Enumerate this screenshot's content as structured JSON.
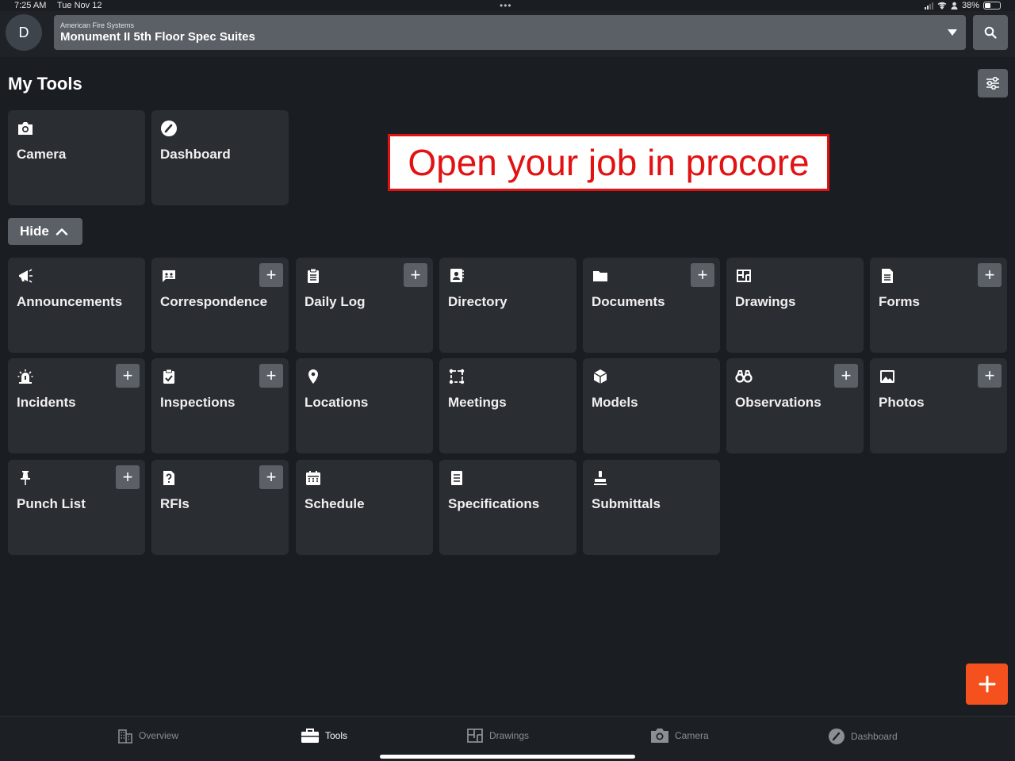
{
  "status_bar": {
    "time": "7:25 AM",
    "date": "Tue Nov 12",
    "dots": "•••",
    "battery": "38%",
    "battery_level": 0.38
  },
  "header": {
    "avatar_initial": "D",
    "company": "American Fire Systems",
    "project": "Monument II 5th Floor Spec Suites",
    "search_icon": "search-icon"
  },
  "page": {
    "title": "My Tools",
    "settings_icon": "sliders-icon"
  },
  "favorites": [
    {
      "label": "Camera",
      "icon": "camera-icon"
    },
    {
      "label": "Dashboard",
      "icon": "gauge-icon"
    }
  ],
  "hide_button": {
    "label": "Hide",
    "icon": "chevron-up-icon"
  },
  "callout": {
    "text": "Open your job in procore",
    "color": "#e31212"
  },
  "tools": [
    {
      "label": "Announcements",
      "icon": "megaphone-icon",
      "add": false
    },
    {
      "label": "Correspondence",
      "icon": "chat-icon",
      "add": true
    },
    {
      "label": "Daily Log",
      "icon": "clipboard-icon",
      "add": true
    },
    {
      "label": "Directory",
      "icon": "contact-book-icon",
      "add": false
    },
    {
      "label": "Documents",
      "icon": "folder-icon",
      "add": true
    },
    {
      "label": "Drawings",
      "icon": "floorplan-icon",
      "add": false
    },
    {
      "label": "Forms",
      "icon": "form-icon",
      "add": true
    },
    {
      "label": "Incidents",
      "icon": "siren-icon",
      "add": true
    },
    {
      "label": "Inspections",
      "icon": "clipboard-check-icon",
      "add": true
    },
    {
      "label": "Locations",
      "icon": "map-pin-icon",
      "add": false
    },
    {
      "label": "Meetings",
      "icon": "meeting-icon",
      "add": false
    },
    {
      "label": "Models",
      "icon": "cube-icon",
      "add": false
    },
    {
      "label": "Observations",
      "icon": "binoculars-icon",
      "add": true
    },
    {
      "label": "Photos",
      "icon": "image-icon",
      "add": true
    },
    {
      "label": "Punch List",
      "icon": "pushpin-icon",
      "add": true
    },
    {
      "label": "RFIs",
      "icon": "question-doc-icon",
      "add": true
    },
    {
      "label": "Schedule",
      "icon": "calendar-icon",
      "add": false
    },
    {
      "label": "Specifications",
      "icon": "spec-doc-icon",
      "add": false
    },
    {
      "label": "Submittals",
      "icon": "stamp-icon",
      "add": false
    }
  ],
  "add_symbol": "+",
  "fab": {
    "icon": "plus-icon",
    "color": "#f4511e"
  },
  "bottom_nav": [
    {
      "label": "Overview",
      "icon": "building-icon",
      "active": false
    },
    {
      "label": "Tools",
      "icon": "toolbox-icon",
      "active": true
    },
    {
      "label": "Drawings",
      "icon": "floorplan-icon",
      "active": false
    },
    {
      "label": "Camera",
      "icon": "camera-icon",
      "active": false
    },
    {
      "label": "Dashboard",
      "icon": "gauge-icon",
      "active": false
    }
  ]
}
